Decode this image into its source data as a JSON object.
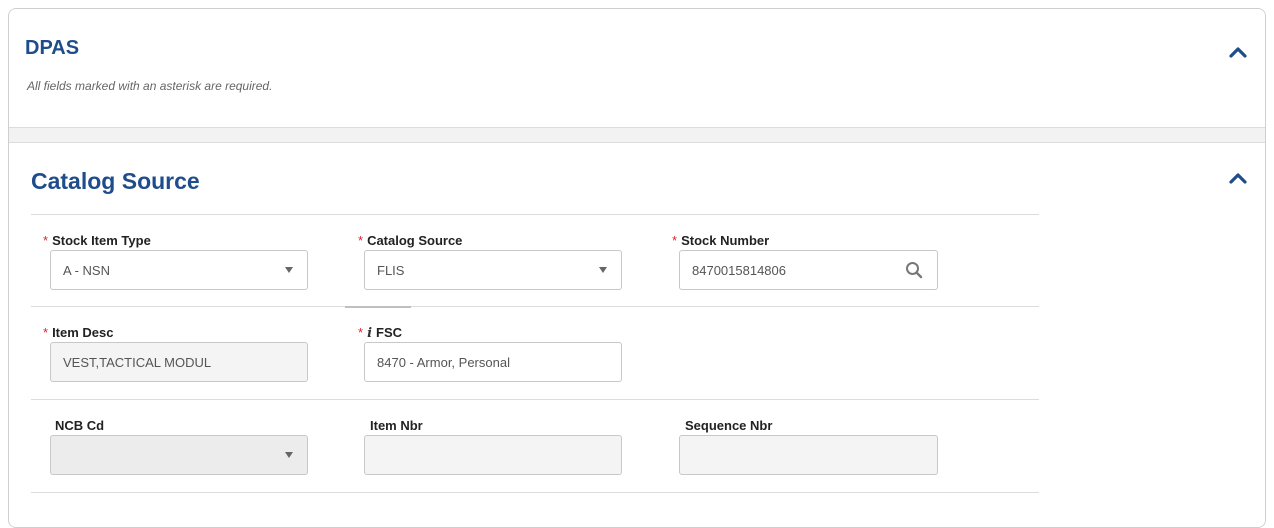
{
  "dpas": {
    "title": "DPAS",
    "note": "All fields marked with an asterisk are required."
  },
  "catalog": {
    "title": "Catalog Source",
    "required_marker": "*",
    "info_marker": "i",
    "fields": {
      "stock_item_type": {
        "label": "Stock Item Type",
        "value": "A - NSN"
      },
      "catalog_source": {
        "label": "Catalog Source",
        "value": "FLIS"
      },
      "stock_number": {
        "label": "Stock Number",
        "value": "8470015814806"
      },
      "item_desc": {
        "label": "Item Desc",
        "value": "VEST,TACTICAL MODUL"
      },
      "fsc": {
        "label": "FSC",
        "value": "8470 - Armor, Personal"
      },
      "ncb_cd": {
        "label": "NCB Cd",
        "value": ""
      },
      "item_nbr": {
        "label": "Item Nbr",
        "value": ""
      },
      "sequence_nbr": {
        "label": "Sequence Nbr",
        "value": ""
      }
    }
  },
  "icons": {
    "collapse": "chevron-up-icon",
    "dropdown": "caret-down-icon",
    "search": "search-icon",
    "info": "info-icon"
  },
  "colors": {
    "title": "#1f4d8c",
    "required": "#d9262e",
    "border": "#c8c8c8"
  }
}
